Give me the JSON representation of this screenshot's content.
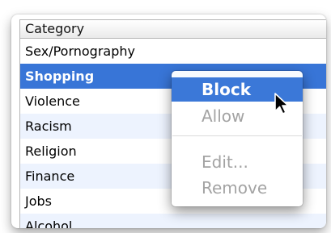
{
  "table": {
    "header": "Category",
    "rows": [
      {
        "label": "Sex/Pornography"
      },
      {
        "label": "Shopping"
      },
      {
        "label": "Violence"
      },
      {
        "label": "Racism"
      },
      {
        "label": "Religion"
      },
      {
        "label": "Finance"
      },
      {
        "label": "Jobs"
      },
      {
        "label": "Alcohol"
      }
    ],
    "selected_index": 1
  },
  "context_menu": {
    "items": [
      {
        "label": "Block"
      },
      {
        "label": "Allow"
      },
      {
        "label": "Edit..."
      },
      {
        "label": "Remove"
      }
    ]
  },
  "colors": {
    "selection": "#3875d7",
    "alternate_row": "#edf3fe",
    "menu_highlight": "#3b78d8",
    "disabled_text": "#a3a3a3"
  },
  "icons": {
    "cursor": "arrow-pointer-icon"
  }
}
